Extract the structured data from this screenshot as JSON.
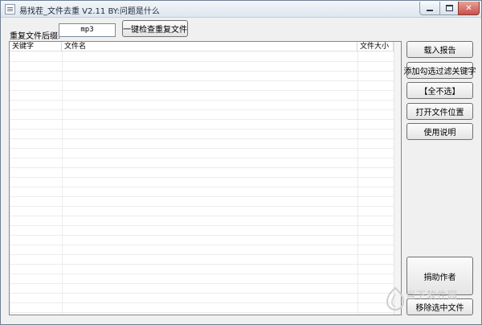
{
  "window": {
    "title": "易找茬_文件去重 V2.11  BY:问题是什么",
    "controls": {
      "minimize": "min",
      "maximize": "max",
      "close": "✕"
    },
    "icon": "app-icon"
  },
  "toolbar": {
    "suffix_label": "重复文件后缀:",
    "suffix_value": "mp3",
    "check_button": "一键检查重复文件"
  },
  "list": {
    "columns": [
      "关键字",
      "文件名",
      "文件大小"
    ],
    "rows": []
  },
  "side_buttons": {
    "load_report": "载入报告",
    "add_filter_keyword": "添加勾选过滤关键字",
    "select_none": "【全不选】",
    "open_file_location": "打开文件位置",
    "instructions": "使用说明",
    "donate": "捐助作者",
    "remove_selected": "移除选中文件"
  },
  "watermark": {
    "text": "当下软件园",
    "icon": "watermark-logo-icon"
  },
  "colors": {
    "window_bg": "#f0f0f0",
    "close_button": "#c75050",
    "list_bg": "#ffffff"
  }
}
